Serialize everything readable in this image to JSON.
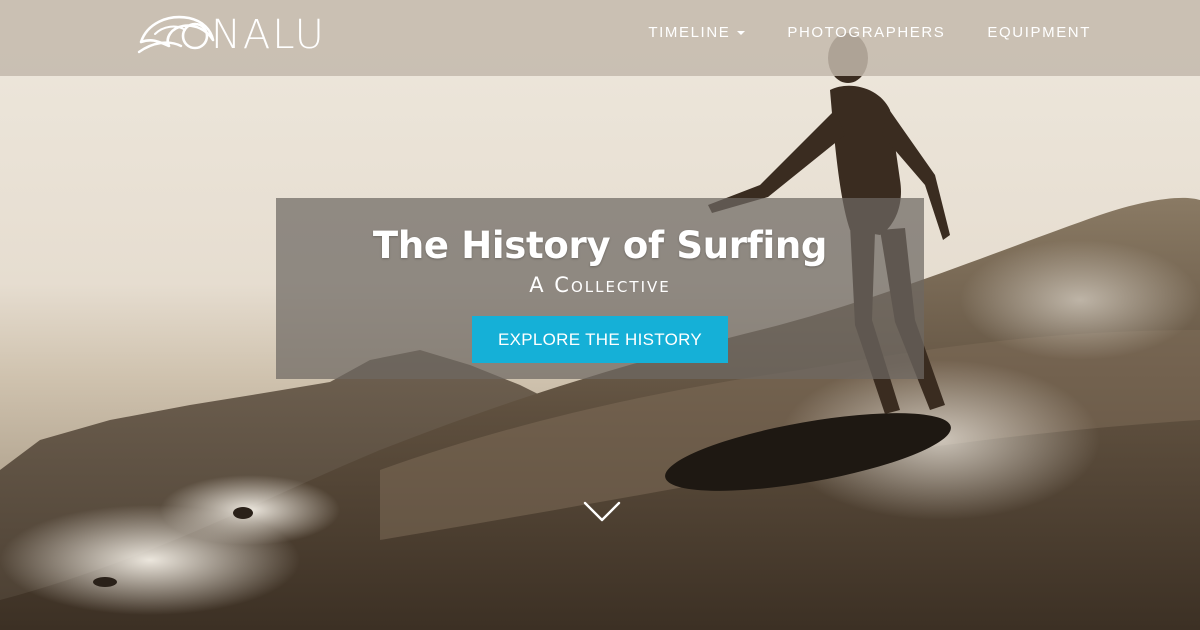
{
  "brand": {
    "logo_icon": "wave-icon",
    "name": "NALU"
  },
  "nav": {
    "items": [
      {
        "label": "TIMELINE",
        "has_dropdown": true
      },
      {
        "label": "PHOTOGRAPHERS",
        "has_dropdown": false
      },
      {
        "label": "EQUIPMENT",
        "has_dropdown": false
      }
    ]
  },
  "hero": {
    "title": "The History of Surfing",
    "subtitle": "A Collective",
    "cta_label": "EXPLORE THE HISTORY",
    "scroll_icon": "chevron-down-icon"
  },
  "colors": {
    "accent": "#15b0d7",
    "overlay": "#6e6862",
    "nav_bar": "#c3b9ac",
    "sepia_light": "#eee8dd",
    "sepia_dark": "#3c3024"
  }
}
